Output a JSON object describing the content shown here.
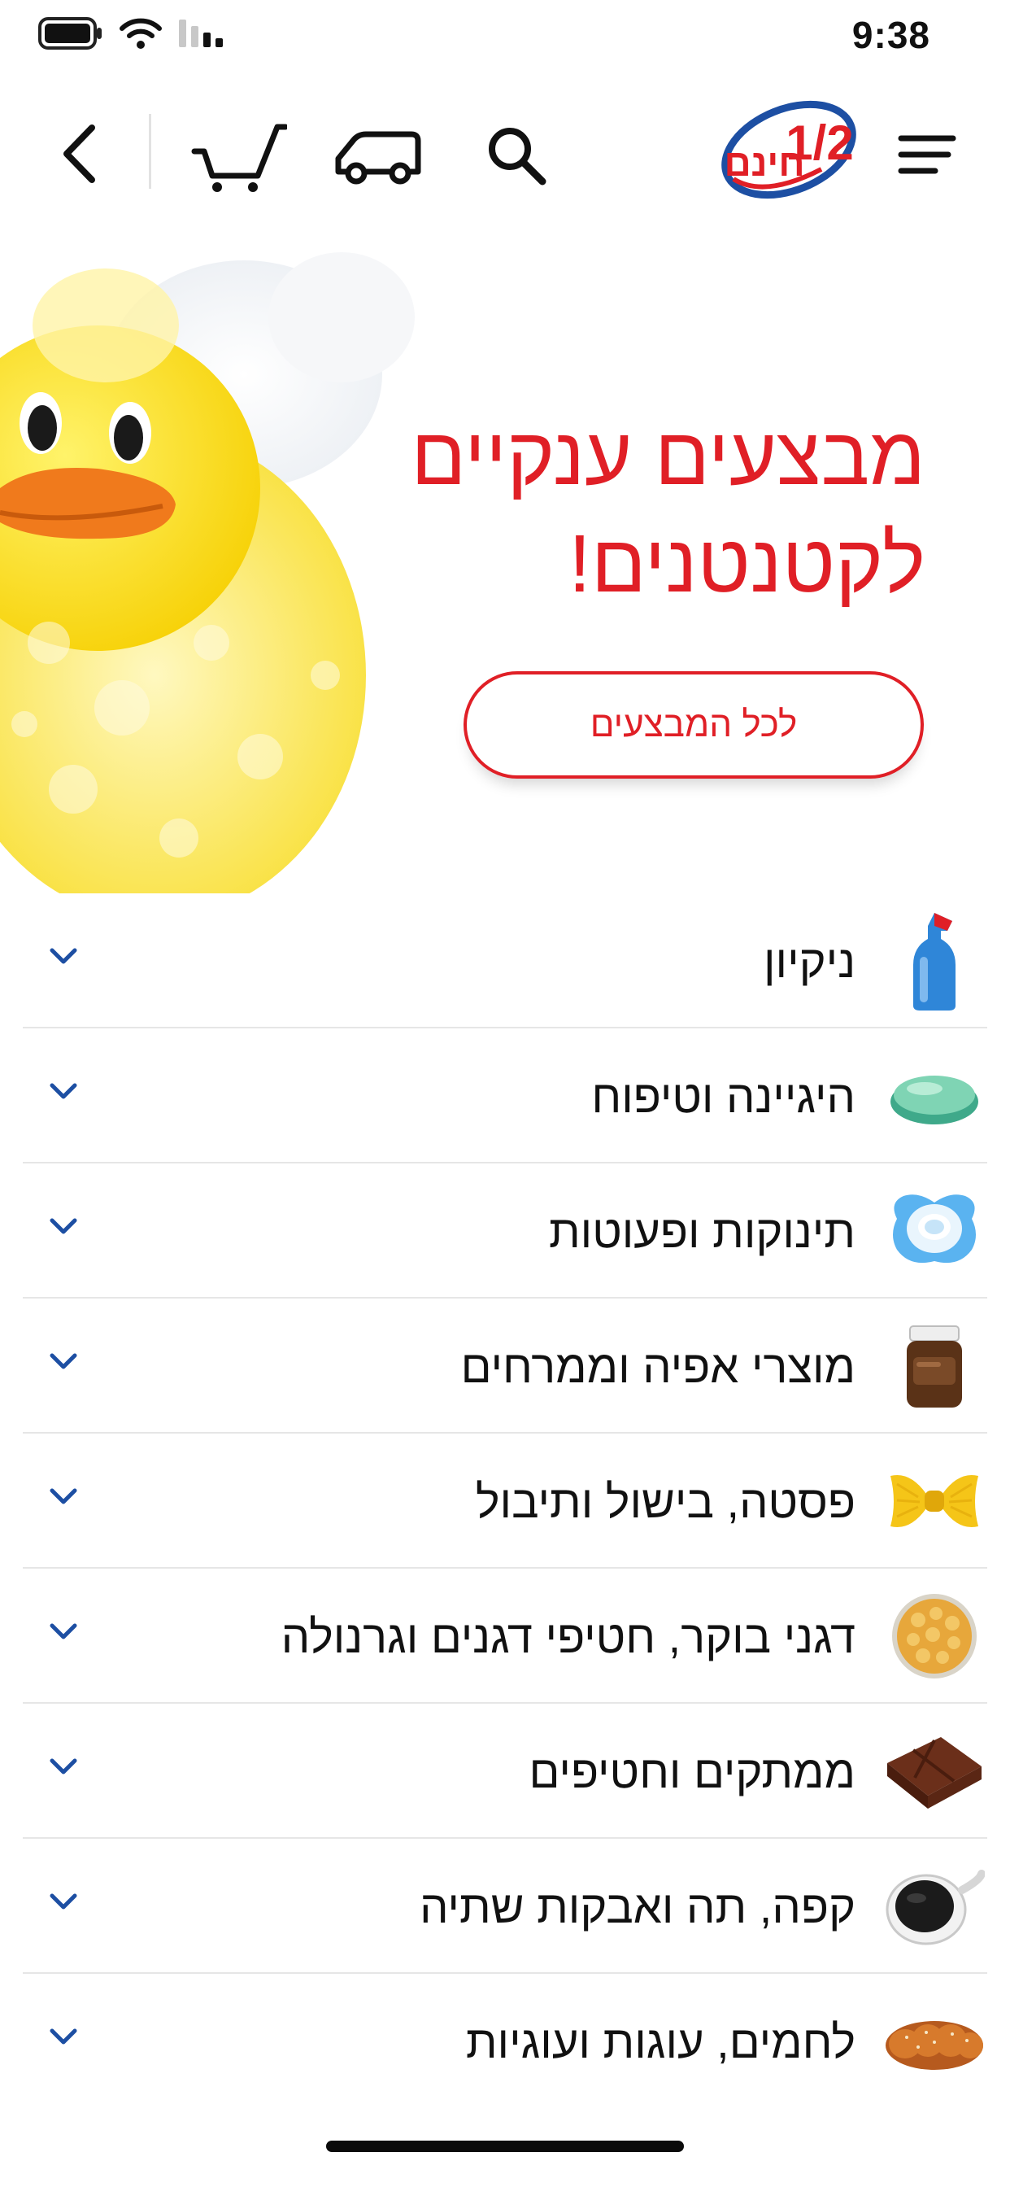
{
  "status_bar": {
    "time": "9:38"
  },
  "nav": {
    "back_icon": "chevron-left-icon",
    "cart_icon": "cart-icon",
    "delivery_icon": "truck-icon",
    "search_icon": "search-icon",
    "logo_text": "חינם",
    "logo_fraction": "1/2",
    "menu_icon": "menu-icon"
  },
  "hero": {
    "title_line1": "מבצעים ענקיים",
    "title_line2": "לקטנטנים!",
    "button_label": "לכל המבצעים"
  },
  "categories": [
    {
      "label": "ניקיון",
      "icon": "cleaning-bottle-icon"
    },
    {
      "label": "היגיינה וטיפוח",
      "icon": "soap-icon"
    },
    {
      "label": "תינוקות ופעוטות",
      "icon": "pacifier-icon"
    },
    {
      "label": "מוצרי אפיה וממרחים",
      "icon": "spread-jar-icon"
    },
    {
      "label": "פסטה, בישול ותיבול",
      "icon": "pasta-icon"
    },
    {
      "label": "דגני בוקר, חטיפי דגנים וגרנולה",
      "icon": "cereal-bowl-icon"
    },
    {
      "label": "ממתקים וחטיפים",
      "icon": "chocolate-icon"
    },
    {
      "label": "קפה, תה ואבקות שתיה",
      "icon": "coffee-cup-icon"
    },
    {
      "label": "לחמים, עוגות ועוגיות",
      "icon": "challah-bread-icon"
    }
  ],
  "colors": {
    "brand_red": "#e01f26",
    "brand_blue": "#1d4fa3",
    "chevron_blue": "#1d4fa3"
  }
}
